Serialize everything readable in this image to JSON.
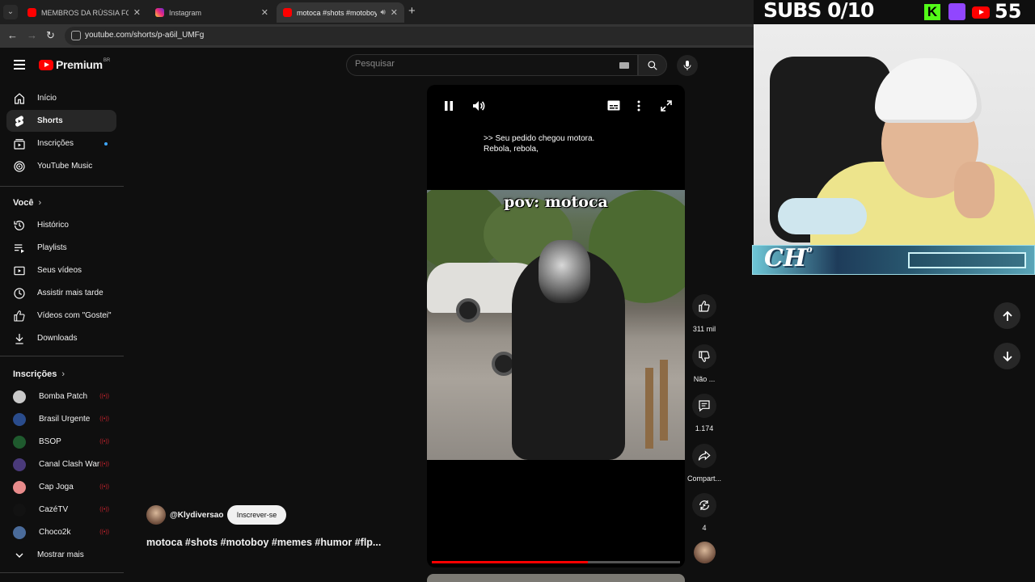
{
  "browser": {
    "tabs": [
      {
        "label": "MEMBROS DA RÚSSIA FORÇAM",
        "favicon": "youtube-icon"
      },
      {
        "label": "Instagram",
        "favicon": "instagram-icon"
      },
      {
        "label": "motoca #shots #motoboy #",
        "favicon": "youtube-icon"
      }
    ],
    "url": "youtube.com/shorts/p-a6il_UMFg"
  },
  "masthead": {
    "brand": "Premium",
    "region": "BR",
    "search_placeholder": "Pesquisar"
  },
  "sidebar": {
    "main": [
      {
        "label": "Início",
        "icon": "home-icon"
      },
      {
        "label": "Shorts",
        "icon": "shorts-icon"
      },
      {
        "label": "Inscrições",
        "icon": "subscriptions-icon"
      },
      {
        "label": "YouTube Music",
        "icon": "music-icon"
      }
    ],
    "you_heading": "Você",
    "you": [
      {
        "label": "Histórico",
        "icon": "history-icon"
      },
      {
        "label": "Playlists",
        "icon": "playlist-icon"
      },
      {
        "label": "Seus vídeos",
        "icon": "your-videos-icon"
      },
      {
        "label": "Assistir mais tarde",
        "icon": "watch-later-icon"
      },
      {
        "label": "Vídeos com \"Gostei\"",
        "icon": "liked-icon"
      },
      {
        "label": "Downloads",
        "icon": "download-icon"
      }
    ],
    "subs_heading": "Inscrições",
    "subscriptions": [
      {
        "label": "Bomba Patch",
        "color": "#c9c9c9"
      },
      {
        "label": "Brasil Urgente",
        "color": "#2a4c8c"
      },
      {
        "label": "BSOP",
        "color": "#1f5a2e"
      },
      {
        "label": "Canal Clash War",
        "color": "#4a3a7a"
      },
      {
        "label": "Cap Joga",
        "color": "#e88b8b"
      },
      {
        "label": "CazéTV",
        "color": "#121212"
      },
      {
        "label": "Choco2k",
        "color": "#4a6b9a"
      }
    ],
    "show_more": "Mostrar mais"
  },
  "short": {
    "caption_lines": [
      ">> Seu pedido chegou motora.",
      "Rebola, rebola,"
    ],
    "overlay_title": "pov: motoca",
    "progress": 0.63,
    "channel": "@Klydiversao",
    "subscribe_label": "Inscrever-se",
    "title": "motoca #shots #motoboy #memes #humor #flp..."
  },
  "actions": {
    "likes": "311 mil",
    "dislike_label": "Não ...",
    "comments": "1.174",
    "share_label": "Compart...",
    "remix_count": "4"
  },
  "stream_overlay": {
    "subs_goal": "SUBS 0/10",
    "kick_letter": "K",
    "viewer_count": "55",
    "logo_text": "CH",
    "logo_mark": "o"
  },
  "colors": {
    "accent": "#ff0000",
    "background": "#0f0f0f",
    "live_dot": "#3ea6ff"
  }
}
